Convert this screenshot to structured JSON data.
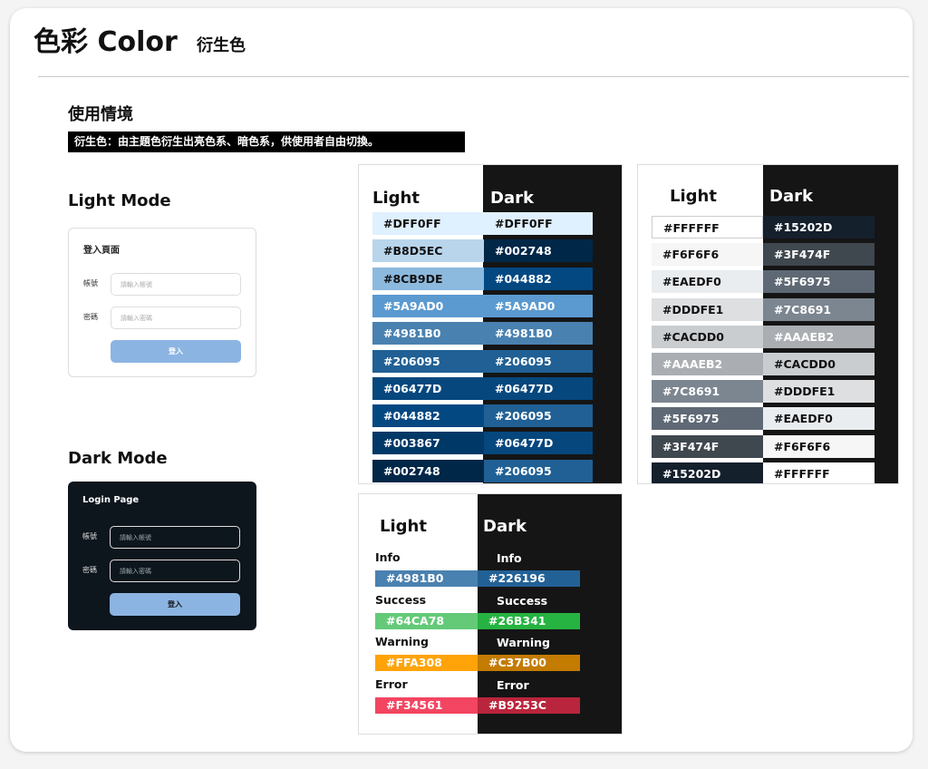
{
  "header": {
    "title": "色彩 Color",
    "subtitle": "衍生色"
  },
  "usage": {
    "heading": "使用情境",
    "description": "衍生色：由主題色衍生出亮色系、暗色系，供使用者自由切換。"
  },
  "light_mode": {
    "heading": "Light Mode",
    "page_title": "登入頁面",
    "account_label": "帳號",
    "account_placeholder": "請輸入帳號",
    "password_label": "密碼",
    "password_placeholder": "請輸入密碼",
    "login_button": "登入"
  },
  "dark_mode": {
    "heading": "Dark Mode",
    "page_title": "Login Page",
    "account_label": "帳號",
    "account_placeholder": "請輸入帳號",
    "password_label": "密碼",
    "password_placeholder": "請輸入密碼",
    "login_button": "登入"
  },
  "blue_palette": {
    "light_heading": "Light",
    "dark_heading": "Dark",
    "light": [
      {
        "label": "#DFF0FF",
        "color": "#DFF0FF"
      },
      {
        "label": "#B8D5EC",
        "color": "#B8D5EC"
      },
      {
        "label": "#8CB9DE",
        "color": "#8CB9DE"
      },
      {
        "label": "#5A9AD0",
        "color": "#5A9AD0"
      },
      {
        "label": "#4981B0",
        "color": "#4981B0"
      },
      {
        "label": "#206095",
        "color": "#206095"
      },
      {
        "label": "#06477D",
        "color": "#06477D"
      },
      {
        "label": "#044882",
        "color": "#044882"
      },
      {
        "label": "#003867",
        "color": "#003867"
      },
      {
        "label": "#002748",
        "color": "#002748"
      }
    ],
    "dark": [
      {
        "label": "#DFF0FF",
        "color": "#DFF0FF"
      },
      {
        "label": "#002748",
        "color": "#002748"
      },
      {
        "label": "#044882",
        "color": "#044882"
      },
      {
        "label": "#5A9AD0",
        "color": "#5A9AD0"
      },
      {
        "label": "#4981B0",
        "color": "#4981B0"
      },
      {
        "label": "#206095",
        "color": "#206095"
      },
      {
        "label": "#06477D",
        "color": "#06477D"
      },
      {
        "label": "#206095",
        "color": "#206095"
      },
      {
        "label": "#06477D",
        "color": "#06477D"
      },
      {
        "label": "#206095",
        "color": "#206095"
      }
    ]
  },
  "gray_palette": {
    "light_heading": "Light",
    "dark_heading": "Dark",
    "light": [
      {
        "label": "#FFFFFF",
        "color": "#FFFFFF"
      },
      {
        "label": "#F6F6F6",
        "color": "#F6F6F6"
      },
      {
        "label": "#EAEDF0",
        "color": "#EAEDF0"
      },
      {
        "label": "#DDDFE1",
        "color": "#DDDFE1"
      },
      {
        "label": "#CACDD0",
        "color": "#CACDD0"
      },
      {
        "label": "#AAAEB2",
        "color": "#AAAEB2"
      },
      {
        "label": "#7C8691",
        "color": "#7C8691"
      },
      {
        "label": "#5F6975",
        "color": "#5F6975"
      },
      {
        "label": "#3F474F",
        "color": "#3F474F"
      },
      {
        "label": "#15202D",
        "color": "#15202D"
      }
    ],
    "dark": [
      {
        "label": "#15202D",
        "color": "#15202D"
      },
      {
        "label": "#3F474F",
        "color": "#3F474F"
      },
      {
        "label": "#5F6975",
        "color": "#5F6975"
      },
      {
        "label": "#7C8691",
        "color": "#7C8691"
      },
      {
        "label": "#AAAEB2",
        "color": "#AAAEB2"
      },
      {
        "label": "#CACDD0",
        "color": "#CACDD0"
      },
      {
        "label": "#DDDFE1",
        "color": "#DDDFE1"
      },
      {
        "label": "#EAEDF0",
        "color": "#EAEDF0"
      },
      {
        "label": "#F6F6F6",
        "color": "#F6F6F6"
      },
      {
        "label": "#FFFFFF",
        "color": "#FFFFFF"
      }
    ]
  },
  "status_palette": {
    "light_heading": "Light",
    "dark_heading": "Dark",
    "items": [
      {
        "name": "Info",
        "light": "#4981B0",
        "light_color": "#4981B0",
        "dark": "#226196",
        "dark_color": "#226196"
      },
      {
        "name": "Success",
        "light": "#64CA78",
        "light_color": "#64CA78",
        "dark": "#26B341",
        "dark_color": "#26B341"
      },
      {
        "name": "Warning",
        "light": "#FFA308",
        "light_color": "#FFA308",
        "dark": "#C37B00",
        "dark_color": "#C37B00"
      },
      {
        "name": "Error",
        "light": "#F34561",
        "light_color": "#F34561",
        "dark": "#B9253C",
        "dark_color": "#B9253C"
      }
    ]
  }
}
